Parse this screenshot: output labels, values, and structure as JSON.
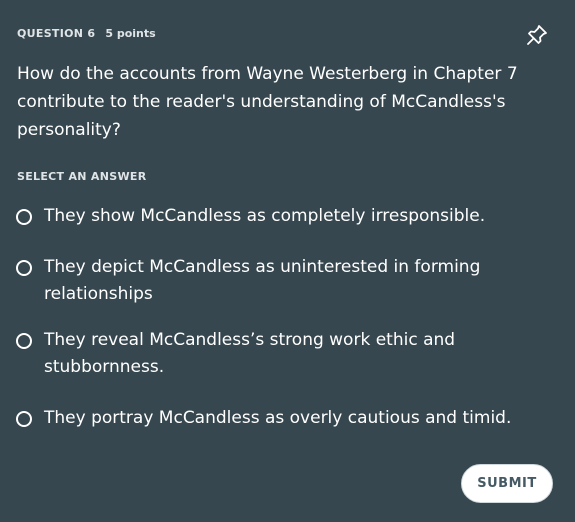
{
  "header": {
    "question_label": "QUESTION 6",
    "points": "5 points"
  },
  "question_text": "How do the accounts from Wayne Westerberg in Chapter 7 contribute to the reader's understanding of McCandless's personality?",
  "select_label": "SELECT AN ANSWER",
  "options": [
    {
      "label": "They show McCandless as completely irresponsible."
    },
    {
      "label": "They depict McCandless as uninterested in forming relationships"
    },
    {
      "label": "They reveal McCandless’s strong work ethic and stubbornness."
    },
    {
      "label": "They portray McCandless as overly cautious and timid."
    }
  ],
  "submit_label": "SUBMIT",
  "icons": {
    "pin": "pin-icon",
    "radio": "radio-icon"
  },
  "colors": {
    "background": "#37474f",
    "text": "#ffffff",
    "submit_text": "#455a64"
  }
}
